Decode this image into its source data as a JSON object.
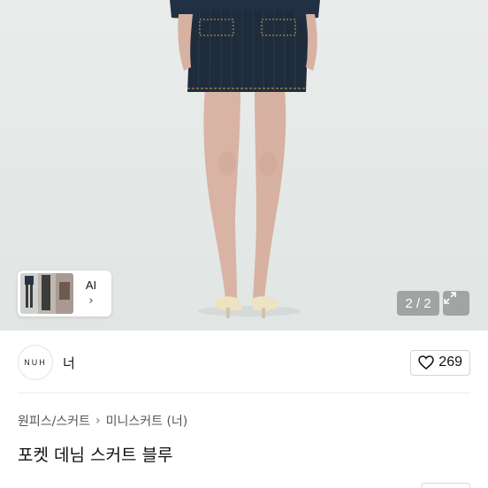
{
  "gallery": {
    "counter": "2 / 2",
    "thumb_ai_label": "AI",
    "thumb_chevron": "›",
    "expand_icon": "expand-icon"
  },
  "shop": {
    "logo_text": "NUH",
    "name": "너",
    "like_count": "269",
    "like_icon": "heart-icon"
  },
  "breadcrumb": {
    "category": "원피스/스커트",
    "separator": "›",
    "subcategory": "미니스커트 (너)"
  },
  "product": {
    "title": "포켓 데님 스커트 블루"
  },
  "colors": {
    "denim": "#1f2c3c",
    "skin": "#d9b5a5",
    "background": "#e6eae9"
  }
}
